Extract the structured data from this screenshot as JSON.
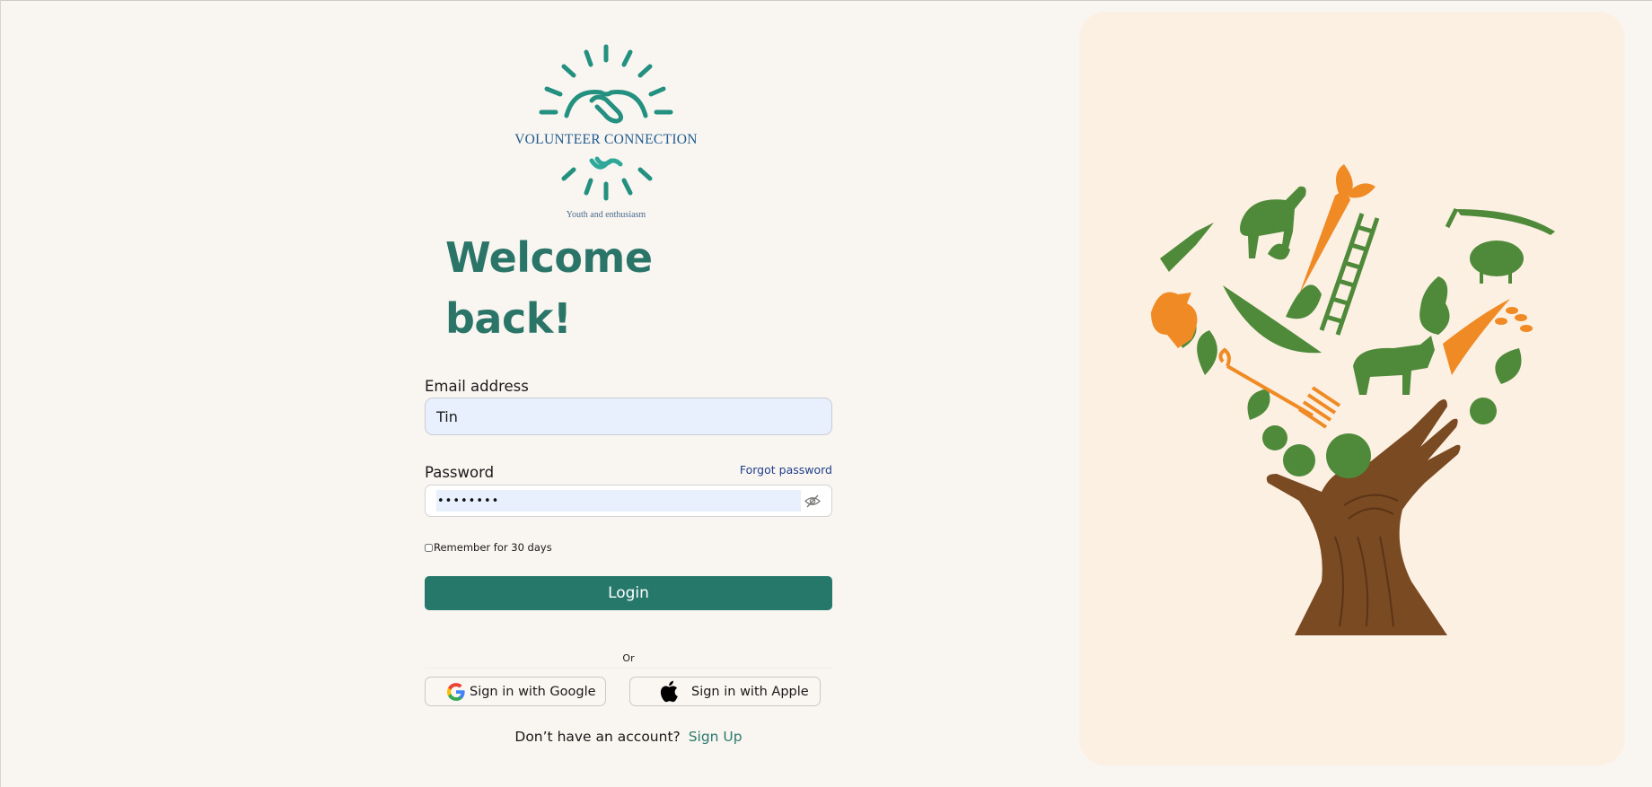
{
  "brand": {
    "name": "VOLUNTEER CONNECTION",
    "tagline": "Youth and enthusiasm"
  },
  "heading": {
    "line1": "Welcome",
    "line2": "back!"
  },
  "email": {
    "label": "Email address",
    "value": "Tin"
  },
  "password": {
    "label": "Password",
    "value": "••••••••",
    "forgot_label": "Forgot password"
  },
  "remember": {
    "label": "Remember for 30 days",
    "checked": false
  },
  "login": {
    "label": "Login"
  },
  "divider": {
    "label": "Or"
  },
  "social": {
    "google_label": "Sign in with Google",
    "apple_label": "Sign in with Apple"
  },
  "signup": {
    "prompt": "Don’t have an account?",
    "link_label": "Sign Up"
  },
  "colors": {
    "accent": "#26786b",
    "heading": "#2b7568",
    "link": "#1e3f8a",
    "input_fill": "#e8f0fd",
    "panel": "#fcf0e3",
    "leaf_green": "#4f8a3a",
    "carrot_orange": "#f08a24",
    "trunk_brown": "#7a4a22"
  },
  "icons": {
    "logo": "sun-handshake-logo",
    "password_toggle": "eye-slash-icon",
    "google": "google-g-icon",
    "apple": "apple-logo-icon",
    "illustration": "farm-tree-hand-illustration"
  }
}
